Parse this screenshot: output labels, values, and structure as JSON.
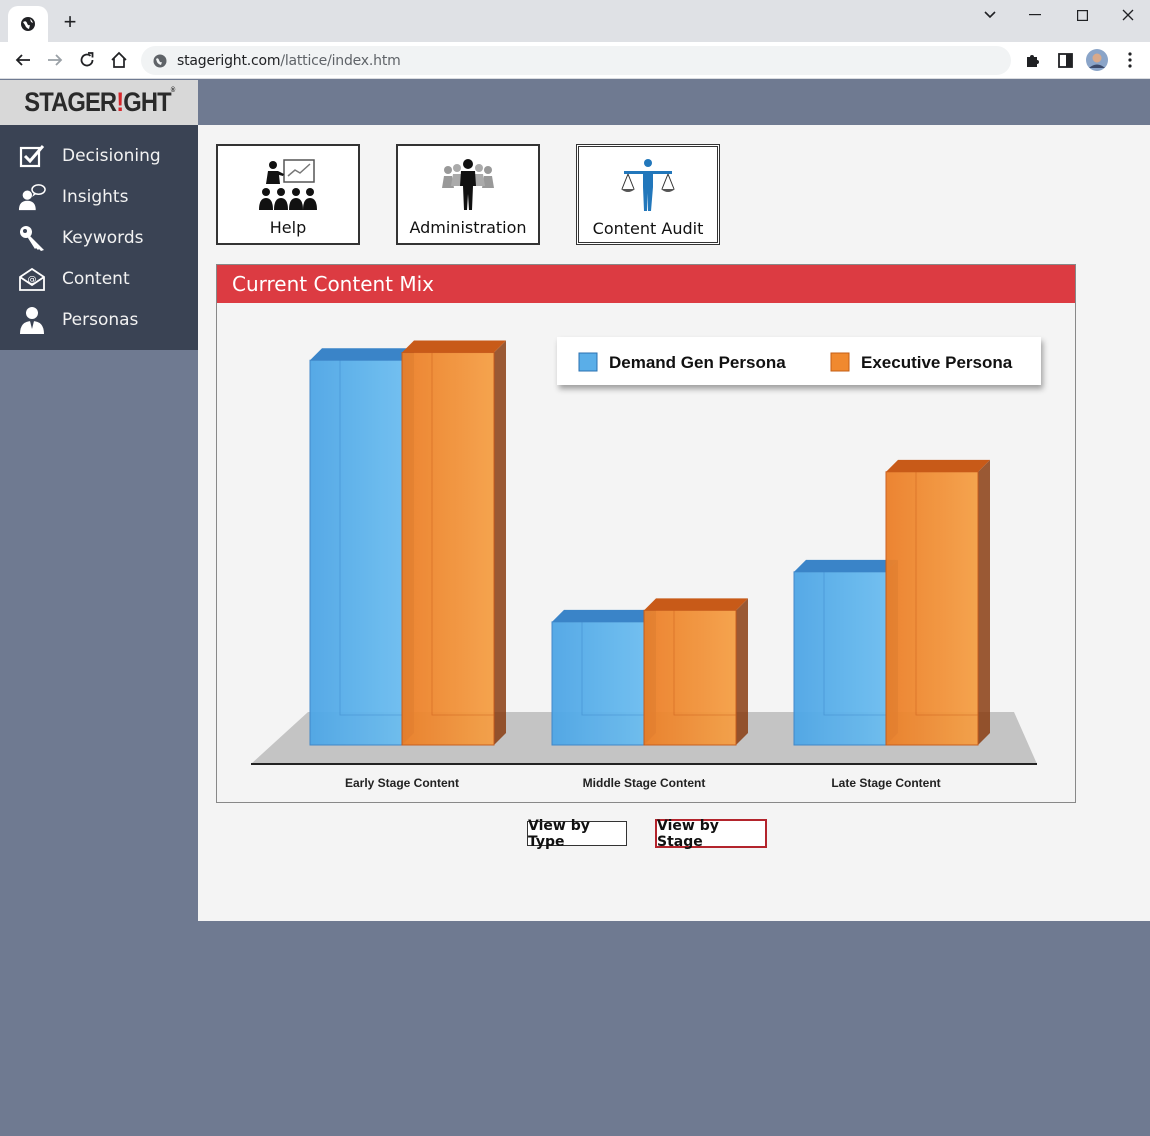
{
  "browser": {
    "url_host": "stageright.com",
    "url_path": "/lattice/index.htm"
  },
  "app": {
    "logo": "STAGERIGHT"
  },
  "sidebar": {
    "items": [
      {
        "label": "Decisioning",
        "icon": "checkbox-icon"
      },
      {
        "label": "Insights",
        "icon": "person-chat-icon"
      },
      {
        "label": "Keywords",
        "icon": "key-icon"
      },
      {
        "label": "Content",
        "icon": "envelope-icon"
      },
      {
        "label": "Personas",
        "icon": "person-icon"
      }
    ]
  },
  "nav_cards": [
    {
      "label": "Help",
      "icon": "presenter-audience-icon"
    },
    {
      "label": "Administration",
      "icon": "team-icon"
    },
    {
      "label": "Content Audit",
      "icon": "scales-person-icon"
    }
  ],
  "panel": {
    "title": "Current Content Mix"
  },
  "chart_data": {
    "type": "bar",
    "categories": [
      "Early Stage Content",
      "Middle Stage Content",
      "Late Stage Content"
    ],
    "series": [
      {
        "name": "Demand Gen Persona",
        "values": [
          100,
          32,
          45
        ],
        "color": "#5aaee8"
      },
      {
        "name": "Executive Persona",
        "values": [
          102,
          35,
          71
        ],
        "color": "#f0892f"
      }
    ],
    "ylim": [
      0,
      105
    ],
    "legend": "top-right",
    "grid": false
  },
  "view_buttons": {
    "by_type": "View by Type",
    "by_stage": "View by Stage"
  }
}
